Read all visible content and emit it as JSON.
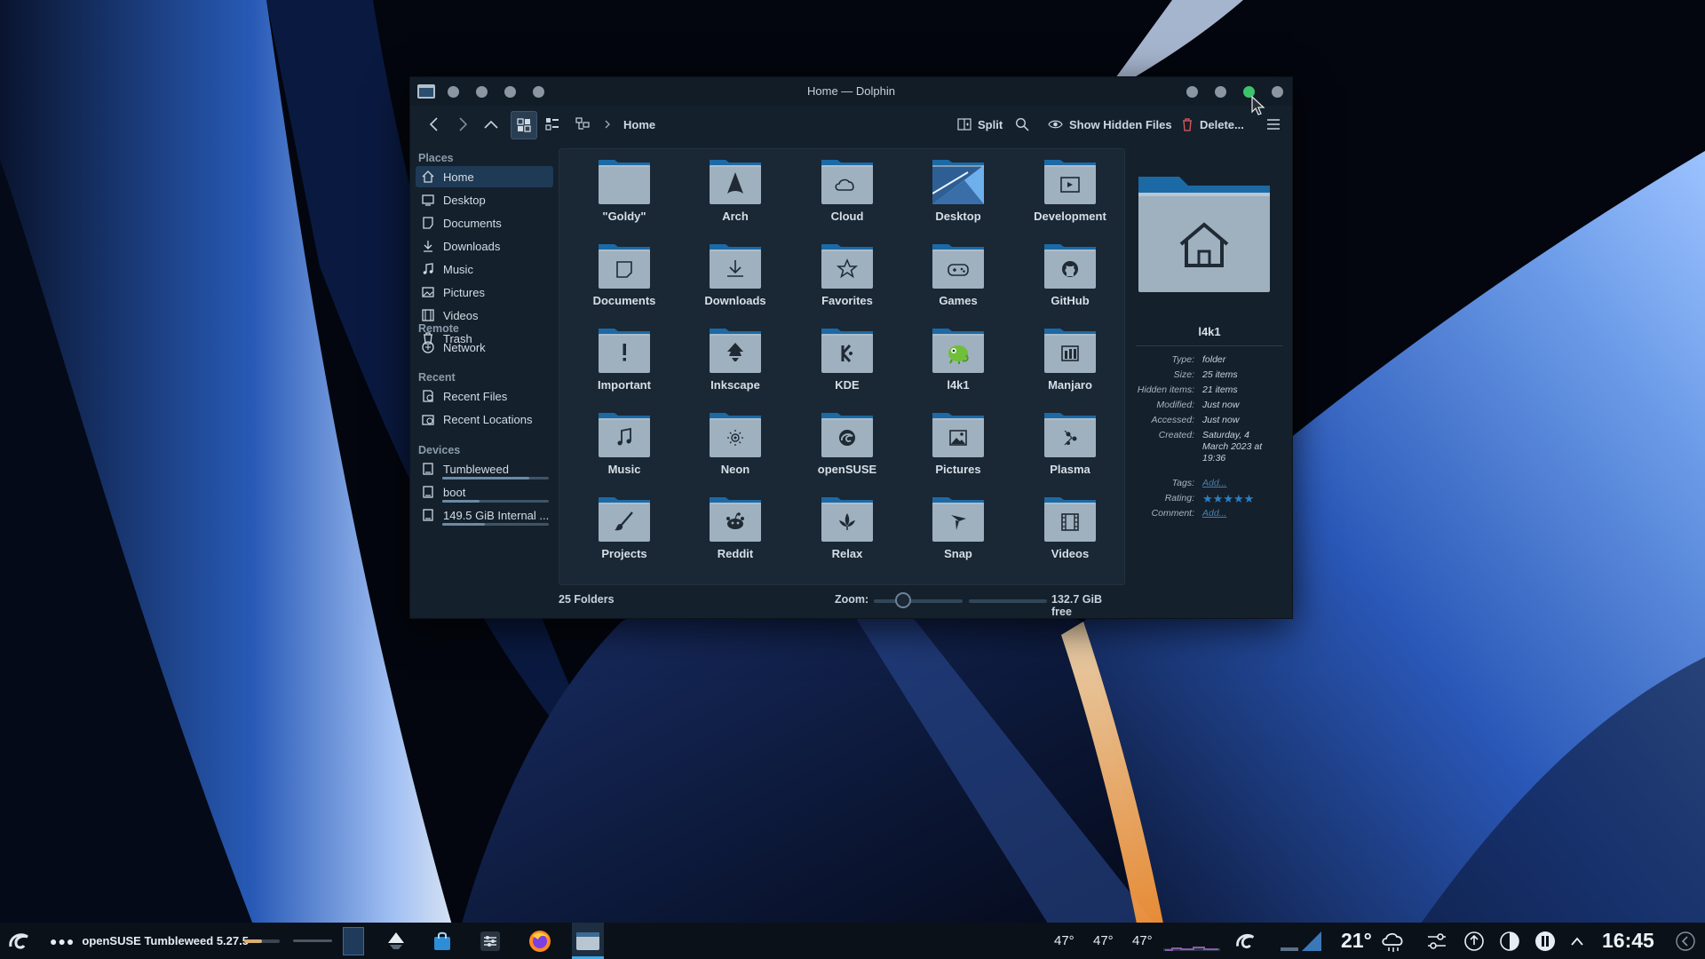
{
  "window": {
    "title": "Home — Dolphin",
    "toolbar": {
      "split_label": "Split",
      "hidden_files_label": "Show Hidden Files",
      "delete_label": "Delete...",
      "breadcrumb": "Home"
    }
  },
  "sidebar": {
    "sections": [
      {
        "title": "Places",
        "items": [
          {
            "label": "Home",
            "icon": "home-icon",
            "selected": true
          },
          {
            "label": "Desktop",
            "icon": "desktop-icon"
          },
          {
            "label": "Documents",
            "icon": "documents-icon"
          },
          {
            "label": "Downloads",
            "icon": "download-icon"
          },
          {
            "label": "Music",
            "icon": "music-icon"
          },
          {
            "label": "Pictures",
            "icon": "pictures-icon"
          },
          {
            "label": "Videos",
            "icon": "videos-icon"
          },
          {
            "label": "Trash",
            "icon": "trash-icon"
          }
        ]
      },
      {
        "title": "Remote",
        "items": [
          {
            "label": "Network",
            "icon": "network-icon"
          }
        ]
      },
      {
        "title": "Recent",
        "items": [
          {
            "label": "Recent Files",
            "icon": "recent-files-icon"
          },
          {
            "label": "Recent Locations",
            "icon": "recent-locations-icon"
          }
        ]
      },
      {
        "title": "Devices",
        "items": [
          {
            "label": "Tumbleweed",
            "icon": "drive-icon"
          },
          {
            "label": "boot",
            "icon": "drive-icon"
          },
          {
            "label": "149.5 GiB Internal ...",
            "icon": "drive-icon"
          }
        ]
      }
    ]
  },
  "folders": [
    {
      "label": "\"Goldy\"",
      "icon": "folder-icon"
    },
    {
      "label": "Arch",
      "icon": "arch-icon"
    },
    {
      "label": "Cloud",
      "icon": "cloud-icon"
    },
    {
      "label": "Desktop",
      "icon": "desktop-folder-icon"
    },
    {
      "label": "Development",
      "icon": "development-icon"
    },
    {
      "label": "Documents",
      "icon": "documents-icon"
    },
    {
      "label": "Downloads",
      "icon": "download-icon"
    },
    {
      "label": "Favorites",
      "icon": "star-icon"
    },
    {
      "label": "Games",
      "icon": "gamepad-icon"
    },
    {
      "label": "GitHub",
      "icon": "github-icon"
    },
    {
      "label": "Important",
      "icon": "exclamation-icon"
    },
    {
      "label": "Inkscape",
      "icon": "inkscape-icon"
    },
    {
      "label": "KDE",
      "icon": "kde-icon"
    },
    {
      "label": "l4k1",
      "icon": "chameleon-icon"
    },
    {
      "label": "Manjaro",
      "icon": "manjaro-icon"
    },
    {
      "label": "Music",
      "icon": "music-icon"
    },
    {
      "label": "Neon",
      "icon": "neon-icon"
    },
    {
      "label": "openSUSE",
      "icon": "opensuse-icon"
    },
    {
      "label": "Pictures",
      "icon": "pictures-icon"
    },
    {
      "label": "Plasma",
      "icon": "plasma-icon"
    },
    {
      "label": "Projects",
      "icon": "brush-icon"
    },
    {
      "label": "Reddit",
      "icon": "reddit-icon"
    },
    {
      "label": "Relax",
      "icon": "leaf-icon"
    },
    {
      "label": "Snap",
      "icon": "snap-icon"
    },
    {
      "label": "Videos",
      "icon": "film-icon"
    }
  ],
  "status": {
    "count": "25 Folders",
    "zoom_label": "Zoom:",
    "free_space": "132.7 GiB free"
  },
  "info_panel": {
    "name": "l4k1",
    "rows": [
      {
        "key": "Type:",
        "value": "folder"
      },
      {
        "key": "Size:",
        "value": "25 items"
      },
      {
        "key": "Hidden items:",
        "value": "21 items"
      },
      {
        "key": "Modified:",
        "value": "Just now"
      },
      {
        "key": "Accessed:",
        "value": "Just now"
      },
      {
        "key": "Created:",
        "value": "Saturday, 4 March 2023 at 19:36"
      },
      {
        "key": "Tags:",
        "value": "Add...",
        "link": true
      },
      {
        "key": "Rating:",
        "value": "",
        "rating": 5
      },
      {
        "key": "Comment:",
        "value": "Add...",
        "link": true
      }
    ]
  },
  "taskbar": {
    "os_label": "openSUSE Tumbleweed 5.27.5",
    "temps": [
      "47°",
      "47°",
      "47°"
    ],
    "weather": "21°",
    "clock": "16:45"
  },
  "colors": {
    "accent": "#1e6da8",
    "folder_tab": "#1b6aa6",
    "folder_body": "#9fb0be",
    "window_bg": "#14202c"
  }
}
